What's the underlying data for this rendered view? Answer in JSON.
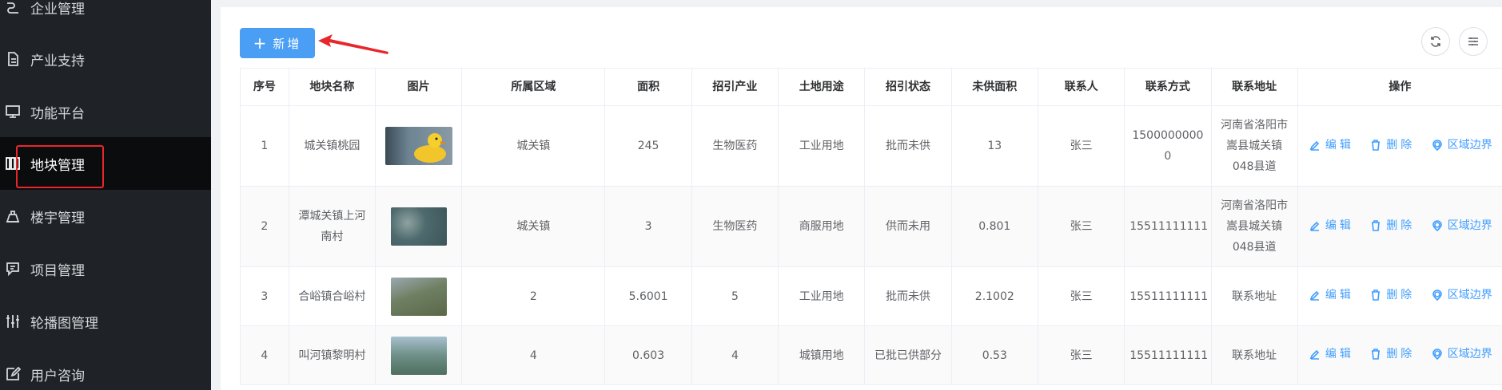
{
  "sidebar": {
    "items": [
      {
        "label": "企业管理",
        "icon": "enterprise-icon"
      },
      {
        "label": "产业支持",
        "icon": "document-icon"
      },
      {
        "label": "功能平台",
        "icon": "monitor-icon"
      },
      {
        "label": "地块管理",
        "icon": "columns-icon",
        "active": true
      },
      {
        "label": "楼宇管理",
        "icon": "building-icon"
      },
      {
        "label": "项目管理",
        "icon": "project-icon"
      },
      {
        "label": "轮播图管理",
        "icon": "sliders-icon"
      },
      {
        "label": "用户咨询",
        "icon": "edit-icon"
      }
    ]
  },
  "toolbar": {
    "add_label": "新增",
    "refresh_icon": "refresh-icon",
    "settings_icon": "filter-settings-icon"
  },
  "table": {
    "headers": [
      "序号",
      "地块名称",
      "图片",
      "所属区域",
      "面积",
      "招引产业",
      "土地用途",
      "招引状态",
      "未供面积",
      "联系人",
      "联系方式",
      "联系地址",
      "操作"
    ],
    "rows": [
      {
        "no": "1",
        "name": "城关镇桃园",
        "image": "duck-photo",
        "region": "城关镇",
        "area": "245",
        "industry": "生物医药",
        "usage": "工业用地",
        "status": "批而未供",
        "unsupplied": "13",
        "contact": "张三",
        "phone": "15000000000",
        "address": "河南省洛阳市嵩县城关镇048县道"
      },
      {
        "no": "2",
        "name": "潭城关镇上河南村",
        "image": "aerial-photo",
        "region": "城关镇",
        "area": "3",
        "industry": "生物医药",
        "usage": "商服用地",
        "status": "供而未用",
        "unsupplied": "0.801",
        "contact": "张三",
        "phone": "15511111111",
        "address": "河南省洛阳市嵩县城关镇048县道"
      },
      {
        "no": "3",
        "name": "合峪镇合峪村",
        "image": "aerial-photo",
        "region": "2",
        "area": "5.6001",
        "industry": "5",
        "usage": "工业用地",
        "status": "批而未供",
        "unsupplied": "2.1002",
        "contact": "张三",
        "phone": "15511111111",
        "address": "联系地址"
      },
      {
        "no": "4",
        "name": "叫河镇黎明村",
        "image": "aerial-photo",
        "region": "4",
        "area": "0.603",
        "industry": "4",
        "usage": "城镇用地",
        "status": "已批已供部分",
        "unsupplied": "0.53",
        "contact": "张三",
        "phone": "15511111111",
        "address": "联系地址"
      }
    ],
    "actions": {
      "edit": "编辑",
      "delete": "删除",
      "boundary": "区域边界"
    }
  },
  "colors": {
    "sidebar_bg": "#1f2327",
    "primary": "#4a9ff5",
    "link": "#409eff",
    "highlight": "#e8262b"
  }
}
